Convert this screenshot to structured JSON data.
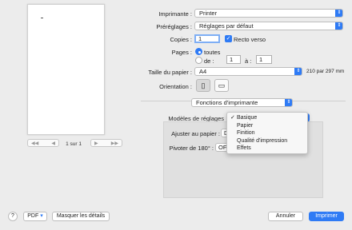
{
  "preview": {
    "prev_first": "◀◀",
    "prev": "◀",
    "next": "▶",
    "next_last": "▶▶",
    "page_indicator": "1 sur 1"
  },
  "printer": {
    "label": "Imprimante :",
    "value": "Printer"
  },
  "presets": {
    "label": "Préréglages :",
    "value": "Réglages par défaut"
  },
  "copies": {
    "label": "Copies :",
    "value": "1",
    "duplex_label": "Recto verso",
    "duplex_checked": true
  },
  "pages": {
    "label": "Pages :",
    "all_label": "toutes",
    "from_label": "de :",
    "from_value": "1",
    "to_label": "à :",
    "to_value": "1"
  },
  "paper": {
    "label": "Taille du papier :",
    "value": "A4",
    "dimensions": "210 par 297 mm"
  },
  "orientation": {
    "label": "Orientation :"
  },
  "section": {
    "value": "Fonctions d'imprimante"
  },
  "feature_sets": {
    "label": "Modèles de réglages",
    "menu": [
      "Basique",
      "Papier",
      "Finition",
      "Qualité d'impression",
      "Effets"
    ],
    "selected": "Basique"
  },
  "fit_to_paper": {
    "label": "Ajuster au papier :",
    "value": "De"
  },
  "rotate": {
    "label": "Pivoter de 180° :",
    "value": "OFF"
  },
  "footer": {
    "help": "?",
    "pdf": "PDF",
    "details": "Masquer les détails",
    "cancel": "Annuler",
    "print": "Imprimer"
  },
  "colors": {
    "accent": "#2f7bf5"
  }
}
